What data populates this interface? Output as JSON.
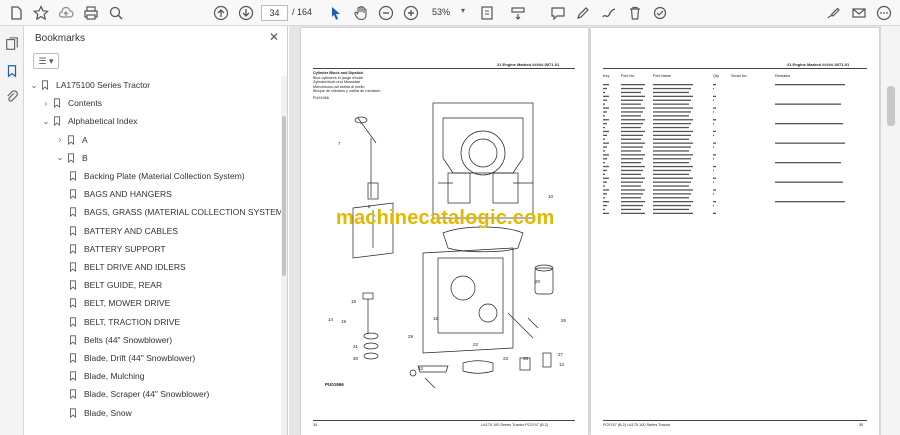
{
  "toolbar": {
    "current_page": "34",
    "page_total": "/ 164",
    "zoom": "53%"
  },
  "panel": {
    "title": "Bookmarks",
    "items": [
      {
        "label": "LA175100 Series Tractor",
        "level": 0,
        "expand": "open"
      },
      {
        "label": "Contents",
        "level": 1,
        "expand": "closed"
      },
      {
        "label": "Alphabetical Index",
        "level": 1,
        "expand": "open"
      },
      {
        "label": "A",
        "level": 2,
        "expand": "closed"
      },
      {
        "label": "B",
        "level": 2,
        "expand": "open"
      },
      {
        "label": "Backing Plate (Material Collection System)",
        "level": 3,
        "expand": "none"
      },
      {
        "label": "BAGS AND HANGERS",
        "level": 3,
        "expand": "none"
      },
      {
        "label": "BAGS, GRASS (MATERIAL COLLECTION SYSTEM)",
        "level": 3,
        "expand": "none"
      },
      {
        "label": "BATTERY AND CABLES",
        "level": 3,
        "expand": "none"
      },
      {
        "label": "BATTERY SUPPORT",
        "level": 3,
        "expand": "none"
      },
      {
        "label": "BELT DRIVE AND IDLERS",
        "level": 3,
        "expand": "none"
      },
      {
        "label": "BELT GUIDE, REAR",
        "level": 3,
        "expand": "none"
      },
      {
        "label": "BELT, MOWER DRIVE",
        "level": 3,
        "expand": "none"
      },
      {
        "label": "BELT, TRACTION DRIVE",
        "level": 3,
        "expand": "none"
      },
      {
        "label": "Belts (44\" Snowblower)",
        "level": 3,
        "expand": "none"
      },
      {
        "label": "Blade, Drift (44\" Snowblower)",
        "level": 3,
        "expand": "none"
      },
      {
        "label": "Blade, Mulching",
        "level": 3,
        "expand": "none"
      },
      {
        "label": "Blade, Scraper (44\" Snowblower)",
        "level": 3,
        "expand": "none"
      },
      {
        "label": "Blade, Snow",
        "level": 3,
        "expand": "none"
      }
    ]
  },
  "document": {
    "watermark": "machinecatalogic.com",
    "left_page": {
      "header": "21 Engine Marked #####-0071-01",
      "title_lines": [
        "Cylinder Block and Dipstick",
        "Bloc-cylindres et jauge d'huile",
        "Zylinderblock und Messstab",
        "Monoblocco ad astina di livello",
        "Bloque de cilindros y varilla de medición"
      ],
      "figure_code": "PU01966",
      "footer_page": "34",
      "footer_title": "LA175 100 Series Tractor   PC9747   (B.2)"
    },
    "right_page": {
      "header": "21 Engine Marked #####-0071-01",
      "columns": [
        "Key",
        "Part No.",
        "Part Name",
        "Qty",
        "Serial No.",
        "Remarks"
      ],
      "footer_page": "35",
      "footer_title": "PC9747   (B.2)   LA175 100 Series Tractor"
    }
  },
  "colors": {
    "watermark": "#e3b800",
    "accent_blue": "#1a5fb4"
  }
}
